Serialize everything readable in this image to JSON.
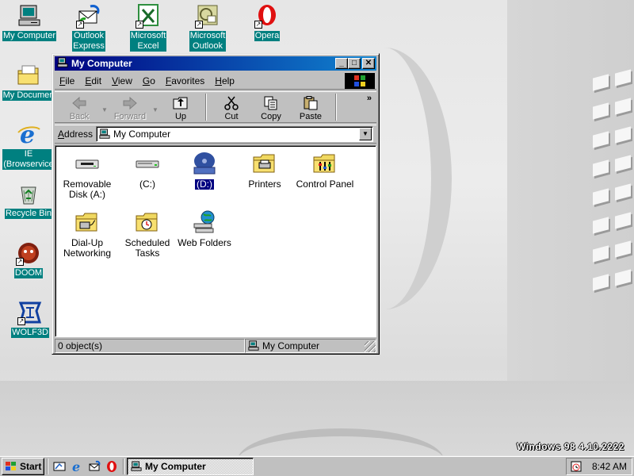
{
  "desktop": {
    "icons": [
      {
        "label": "My Computer",
        "icon": "my-computer-icon"
      },
      {
        "label": "Outlook\nExpress",
        "icon": "outlook-express-icon"
      },
      {
        "label": "Microsoft\nExcel",
        "icon": "excel-icon"
      },
      {
        "label": "Microsoft\nOutlook",
        "icon": "outlook-icon"
      },
      {
        "label": "Opera",
        "icon": "opera-icon"
      },
      {
        "label": "My Documen",
        "icon": "folder-icon"
      },
      {
        "label": "IE\n(Browservice",
        "icon": "internet-explorer-icon"
      },
      {
        "label": "Recycle Bin",
        "icon": "recycle-bin-icon"
      },
      {
        "label": "DOOM",
        "icon": "doom-icon"
      },
      {
        "label": "WOLF3D",
        "icon": "wolf3d-icon"
      }
    ],
    "version_text": "Windows 98 4.10.2222"
  },
  "window": {
    "title": "My Computer",
    "menu": [
      "File",
      "Edit",
      "View",
      "Go",
      "Favorites",
      "Help"
    ],
    "toolbar": {
      "back": "Back",
      "forward": "Forward",
      "up": "Up",
      "cut": "Cut",
      "copy": "Copy",
      "paste": "Paste",
      "more": "»"
    },
    "address": {
      "label": "Address",
      "value": "My Computer"
    },
    "items": [
      {
        "label": "Removable\nDisk (A:)",
        "icon": "floppy-drive-icon"
      },
      {
        "label": "(C:)",
        "icon": "hard-drive-icon"
      },
      {
        "label": "(D:)",
        "icon": "cd-drive-icon",
        "selected": true
      },
      {
        "label": "Printers",
        "icon": "printers-folder-icon"
      },
      {
        "label": "Control Panel",
        "icon": "control-panel-icon"
      },
      {
        "label": "Dial-Up\nNetworking",
        "icon": "dialup-networking-icon"
      },
      {
        "label": "Scheduled\nTasks",
        "icon": "scheduled-tasks-icon"
      },
      {
        "label": "Web Folders",
        "icon": "web-folders-icon"
      }
    ],
    "status": {
      "objects": "0 object(s)",
      "location": "My Computer"
    }
  },
  "taskbar": {
    "start": "Start",
    "task": "My Computer",
    "clock": "8:42 AM"
  },
  "colors": {
    "title_start": "#000080",
    "title_end": "#1084d0",
    "desktop_label_bg": "#008080",
    "face": "#c0c0c0"
  }
}
